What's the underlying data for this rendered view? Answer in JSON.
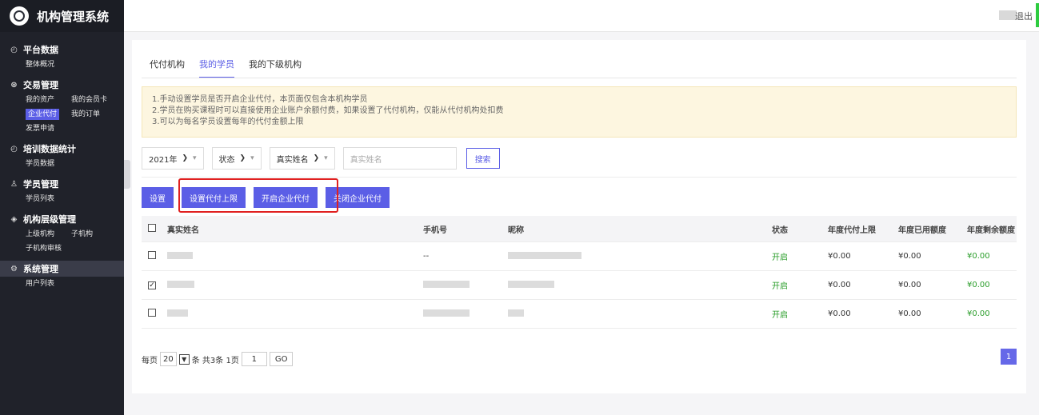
{
  "app": {
    "title": "机构管理系统"
  },
  "sidebar": {
    "groups": [
      {
        "title": "平台数据",
        "icon": "clock-icon",
        "items": [
          "整体概况"
        ]
      },
      {
        "title": "交易管理",
        "icon": "coin-icon",
        "items": [
          "我的资产",
          "我的会员卡",
          "企业代付",
          "我的订单",
          "发票申请"
        ],
        "active": "企业代付"
      },
      {
        "title": "培训数据统计",
        "icon": "clock-icon",
        "items": [
          "学员数据"
        ]
      },
      {
        "title": "学员管理",
        "icon": "user-icon",
        "items": [
          "学员列表"
        ]
      },
      {
        "title": "机构层级管理",
        "icon": "layers-icon",
        "items": [
          "上级机构",
          "子机构",
          "子机构审核"
        ]
      },
      {
        "title": "系统管理",
        "icon": "gear-icon",
        "items": [
          "用户列表"
        ]
      }
    ]
  },
  "topbar": {
    "logout": "退出"
  },
  "tabs": [
    {
      "label": "代付机构",
      "active": false
    },
    {
      "label": "我的学员",
      "active": true
    },
    {
      "label": "我的下级机构",
      "active": false
    }
  ],
  "notice": [
    "1.手动设置学员是否开启企业代付，本页面仅包含本机构学员",
    "2.学员在购买课程时可以直接使用企业账户余额付费，如果设置了代付机构，仅能从代付机构处扣费",
    "3.可以为每名学员设置每年的代付金额上限"
  ],
  "filters": {
    "year": "2021年",
    "status": "状态",
    "field": "真实姓名",
    "placeholder": "真实姓名",
    "search": "搜索"
  },
  "actions": [
    "设置",
    "设置代付上限",
    "开启企业代付",
    "关闭企业代付"
  ],
  "table": {
    "columns": [
      "真实姓名",
      "手机号",
      "昵称",
      "状态",
      "年度代付上限",
      "年度已用额度",
      "年度剩余额度"
    ],
    "rows": [
      {
        "checked": false,
        "phone": "--",
        "status": "开启",
        "limit": "¥0.00",
        "used": "¥0.00",
        "remain": "¥0.00"
      },
      {
        "checked": true,
        "phone": "",
        "status": "开启",
        "limit": "¥0.00",
        "used": "¥0.00",
        "remain": "¥0.00"
      },
      {
        "checked": false,
        "phone": "",
        "status": "开启",
        "limit": "¥0.00",
        "used": "¥0.00",
        "remain": "¥0.00"
      }
    ]
  },
  "pager": {
    "per_page_label": "每页",
    "per_page": "20",
    "summary": "条 共3条 1页",
    "page_input": "1",
    "go": "GO",
    "current_page": "1"
  },
  "colors": {
    "accent": "#5b5ee6",
    "sidebar": "#20222a",
    "open": "#2a9d2a",
    "highlight": "#e02020"
  }
}
